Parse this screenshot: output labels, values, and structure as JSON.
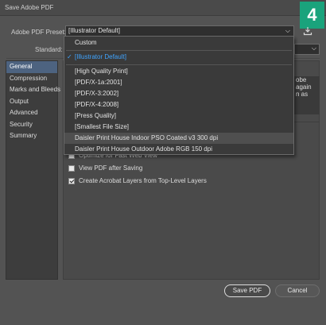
{
  "window": {
    "title": "Save Adobe PDF"
  },
  "step_badge": "4",
  "preset": {
    "label": "Adobe PDF Preset:",
    "value": "[Illustrator Default]",
    "chevron_icon": "chevron-down-icon",
    "save_icon": "save-preset-icon"
  },
  "standard": {
    "label": "Standard:"
  },
  "sidebar": {
    "items": [
      {
        "label": "General",
        "active": true
      },
      {
        "label": "Compression"
      },
      {
        "label": "Marks and Bleeds"
      },
      {
        "label": "Output"
      },
      {
        "label": "Advanced"
      },
      {
        "label": "Security"
      },
      {
        "label": "Summary"
      }
    ]
  },
  "dropdown": {
    "items": [
      {
        "label": "Custom"
      },
      {
        "label": "[Illustrator Default]",
        "selected": true
      },
      {
        "label": "[High Quality Print]"
      },
      {
        "label": "[PDF/X-1a:2001]"
      },
      {
        "label": "[PDF/X-3:2002]"
      },
      {
        "label": "[PDF/X-4:2008]"
      },
      {
        "label": "[Press Quality]"
      },
      {
        "label": "[Smallest File Size]"
      },
      {
        "label": "Daisler Print House Indoor PSO Coated v3 300 dpi",
        "hover": true
      },
      {
        "label": "Daisler Print House Outdoor Adobe RGB 150 dpi"
      }
    ]
  },
  "side_text": [
    "obe",
    "again",
    "n as"
  ],
  "options": [
    {
      "label": "Optimize for Fast Web View",
      "checked": false
    },
    {
      "label": "View PDF after Saving",
      "checked": false
    },
    {
      "label": "Create Acrobat Layers from Top-Level Layers",
      "checked": true
    }
  ],
  "buttons": {
    "save": "Save PDF",
    "cancel": "Cancel"
  },
  "colors": {
    "accent": "#3fa4ff",
    "badge": "#1aa37c",
    "sidebar_active": "#4d6380"
  }
}
